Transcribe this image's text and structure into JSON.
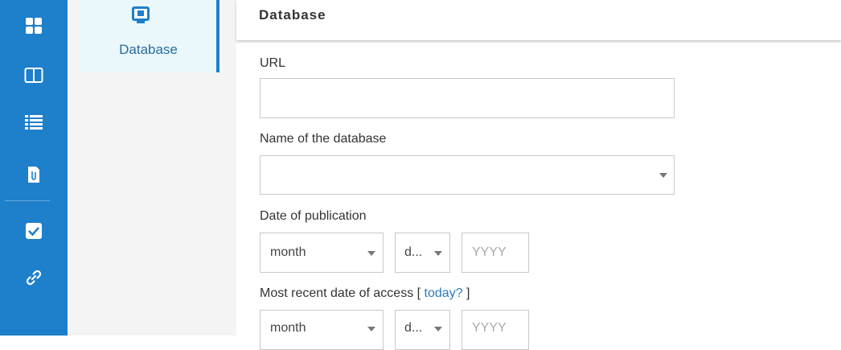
{
  "sidebar": {
    "items": [
      {
        "icon": "grid-icon"
      },
      {
        "icon": "columns-icon"
      },
      {
        "icon": "list-icon"
      },
      {
        "icon": "attachment-icon"
      },
      {
        "icon": "checkbox-icon"
      },
      {
        "icon": "link-icon"
      }
    ]
  },
  "source_type": {
    "label": "Database",
    "icon": "database-monitor-icon"
  },
  "header": {
    "title": "Database"
  },
  "form": {
    "url_label": "URL",
    "url_value": "",
    "db_name_label": "Name of the database",
    "db_name_value": "",
    "pub_date_label": "Date of publication",
    "pub_month": "month",
    "pub_day": "d...",
    "pub_year_placeholder": "YYYY",
    "access_label": "Most recent date of access [ ",
    "access_today_link": "today?",
    "access_label_end": " ]",
    "access_month": "month",
    "access_day": "d...",
    "access_year_placeholder": "YYYY"
  },
  "colors": {
    "rail": "#1e7fca",
    "accent": "#1e7fca",
    "link": "#2a7bbf"
  }
}
